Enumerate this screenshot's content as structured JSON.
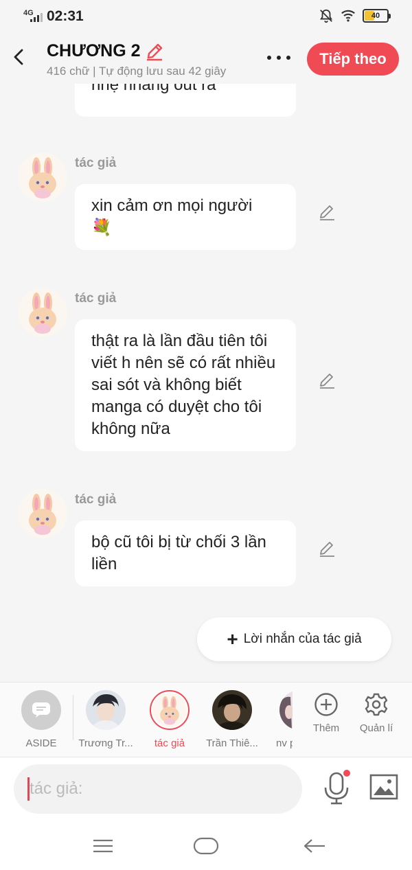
{
  "status_bar": {
    "network": "4G",
    "time": "02:31",
    "battery": "40",
    "battery_level_percent": 40,
    "icons": [
      "signal-icon",
      "mute-bell-icon",
      "wifi-icon",
      "battery-icon"
    ]
  },
  "header": {
    "title": "CHƯƠNG 2",
    "subtitle": "416 chữ | Tự động lưu sau 42 giây",
    "next_label": "Tiếp theo",
    "accent_color": "#f04a55"
  },
  "messages": [
    {
      "author": "",
      "text": "nhẹ nhàng out ra"
    },
    {
      "author": "tác giả",
      "text": "xin cảm ơn mọi người",
      "emoji": "💐"
    },
    {
      "author": "tác giả",
      "text": "thật ra là lần đầu tiên tôi viết h nên sẽ có rất nhiều sai sót và không biết manga có duyệt cho tôi không nữa"
    },
    {
      "author": "tác giả",
      "text": "bộ cũ tôi bị từ chối 3 lần liền"
    }
  ],
  "author_note_label": "Lời nhắn của tác giả",
  "characters": [
    {
      "name": "ASIDE"
    },
    {
      "name": "Trương Tr..."
    },
    {
      "name": "tác giả",
      "selected": true
    },
    {
      "name": "Trần Thiê..."
    },
    {
      "name": "nv p"
    }
  ],
  "tools": {
    "add_label": "Thêm",
    "manage_label": "Quản lí"
  },
  "input": {
    "placeholder": "tác giả:"
  }
}
